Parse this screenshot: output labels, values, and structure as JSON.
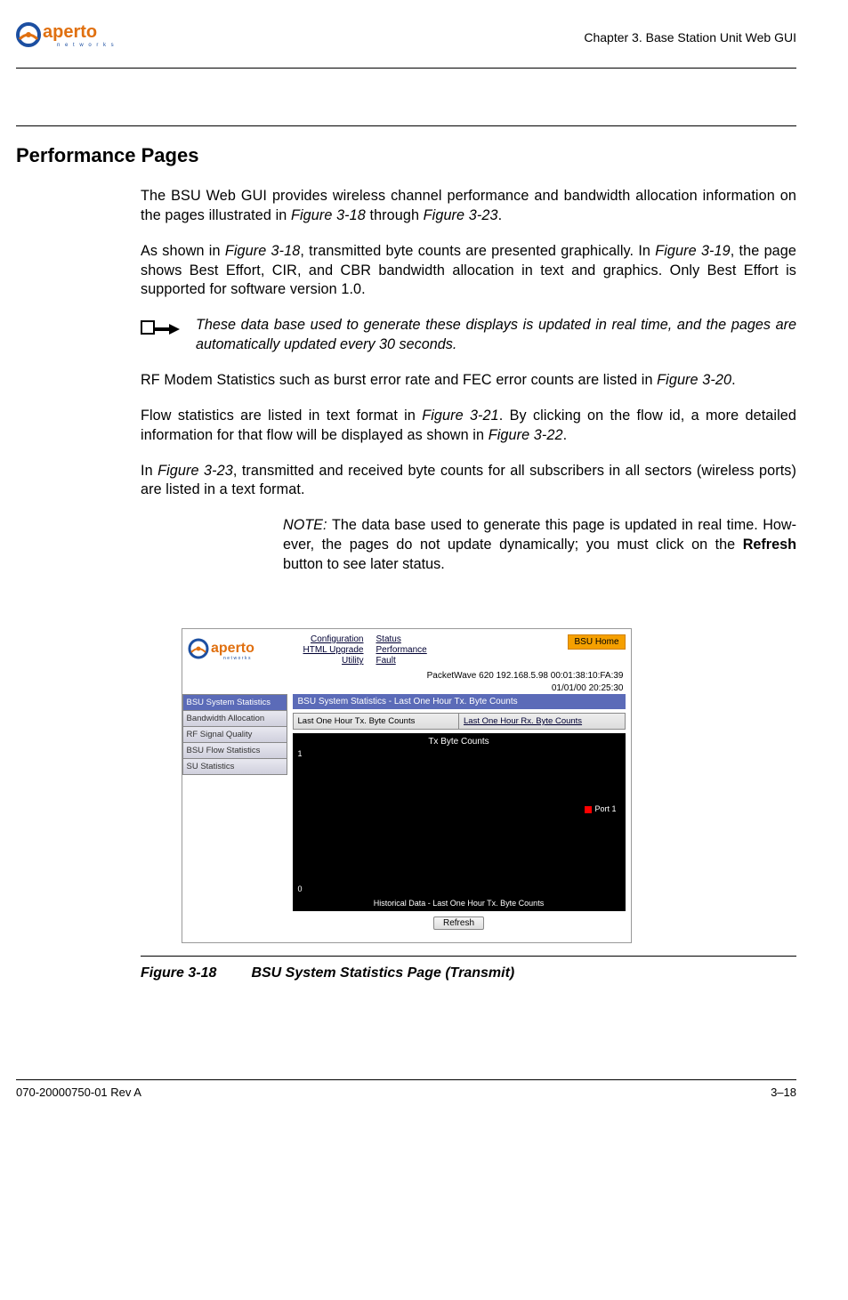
{
  "header": {
    "logo_name": "aperto",
    "logo_sub": "n e t w o r k s",
    "chapter": "Chapter 3.  Base Station Unit Web GUI"
  },
  "section_title": "Performance Pages",
  "paras": {
    "p1a": "The BSU Web GUI provides wireless channel performance and bandwidth allocation infor­mation on the pages illustrated in ",
    "p1b": "Figure 3-18",
    "p1c": " through ",
    "p1d": "Figure 3-23",
    "p1e": ".",
    "p2a": "As shown in ",
    "p2b": "Figure 3-18",
    "p2c": ", transmitted byte counts are presented graphically. In ",
    "p2d": "Figure 3-19",
    "p2e": ", the page shows Best Effort, CIR, and CBR bandwidth allocation in text and graphics. Only Best Effort is supported for software version 1.0.",
    "hand_note": "These data base used to generate these displays is updated in real time, and the pages are automatically updated every 30 seconds.",
    "p3a": "RF Modem Statistics such as burst error rate and FEC error counts are listed in ",
    "p3b": "Figure 3-20",
    "p3c": ".",
    "p4a": "Flow statistics are listed in text format in ",
    "p4b": "Figure 3-21",
    "p4c": ". By clicking on the flow id, a more detailed information for that flow will be displayed as shown in ",
    "p4d": "Figure 3-22",
    "p4e": ".",
    "p5a": "In ",
    "p5b": "Figure 3-23",
    "p5c": ", transmitted and received byte counts for all subscribers in all sectors (wire­less ports) are listed in a text format.",
    "note_label": "NOTE:  ",
    "note_a": "The data base used to generate this page is updated in real time. How­ever, the pages do not update dynamically; you must click on the ",
    "note_b": "Refresh",
    "note_c": " button to see later status."
  },
  "screenshot": {
    "links_col1": [
      "Configuration",
      "HTML Upgrade",
      "Utility"
    ],
    "links_col2": [
      "Status",
      "Performance",
      "Fault"
    ],
    "bsu_home": "BSU Home",
    "info1": "PacketWave 620    192.168.5.98    00:01:38:10:FA:39",
    "info2": "01/01/00    20:25:30",
    "side": [
      "BSU System Statistics",
      "Bandwidth Allocation",
      "RF Signal Quality",
      "BSU Flow Statistics",
      "SU Statistics"
    ],
    "title_bar": "BSU System Statistics - Last One Hour Tx. Byte Counts",
    "tab1": "Last One Hour Tx. Byte Counts",
    "tab2": "Last One Hour Rx. Byte Counts",
    "chart_title": "Tx Byte Counts",
    "legend": "Port 1",
    "y_max": "1",
    "y_min": "0",
    "axis_caption": "Historical Data - Last One Hour Tx. Byte Counts",
    "refresh": "Refresh"
  },
  "chart_data": {
    "type": "line",
    "title": "Tx Byte Counts",
    "xlabel": "Historical Data - Last One Hour Tx. Byte Counts",
    "ylabel": "",
    "ylim": [
      0,
      1
    ],
    "series": [
      {
        "name": "Port 1",
        "values": []
      }
    ]
  },
  "figure": {
    "num": "Figure 3-18",
    "title": "BSU System Statistics Page (Transmit)"
  },
  "footer": {
    "left": "070-20000750-01 Rev A",
    "right": "3–18"
  }
}
